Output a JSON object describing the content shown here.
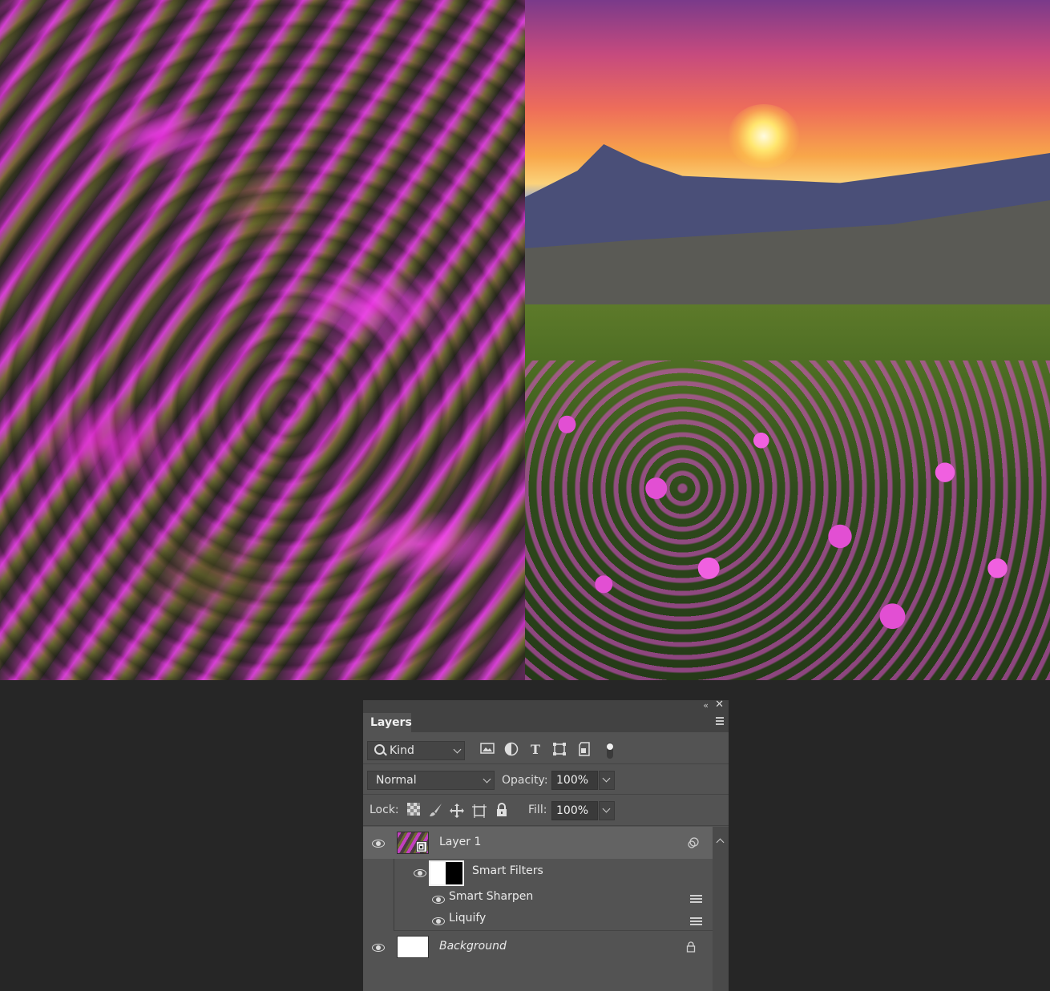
{
  "canvas": {
    "left_image": "liquified-flower-field",
    "right_image": "sunset-mountain-flower-field"
  },
  "panel": {
    "tab_title": "Layers",
    "filter": {
      "kind_label": "Kind",
      "icons": [
        "pixel-filter-icon",
        "adjustment-filter-icon",
        "type-filter-icon",
        "shape-filter-icon",
        "smart-object-filter-icon",
        "filter-toggle-icon"
      ]
    },
    "blend_mode": "Normal",
    "opacity_label": "Opacity:",
    "opacity_value": "100%",
    "lock_label": "Lock:",
    "fill_label": "Fill:",
    "fill_value": "100%",
    "layers": [
      {
        "name": "Layer 1",
        "type": "smart-object",
        "visible": true,
        "selected": true
      },
      {
        "name": "Smart Filters",
        "type": "smart-filters-mask",
        "visible": true
      },
      {
        "name": "Smart Sharpen",
        "type": "filter",
        "visible": true
      },
      {
        "name": "Liquify",
        "type": "filter",
        "visible": true
      },
      {
        "name": "Background",
        "type": "background",
        "visible": true,
        "locked": true
      }
    ]
  },
  "colors": {
    "app_background": "#262626",
    "panel_background": "#535353",
    "selected_layer": "#636363"
  }
}
